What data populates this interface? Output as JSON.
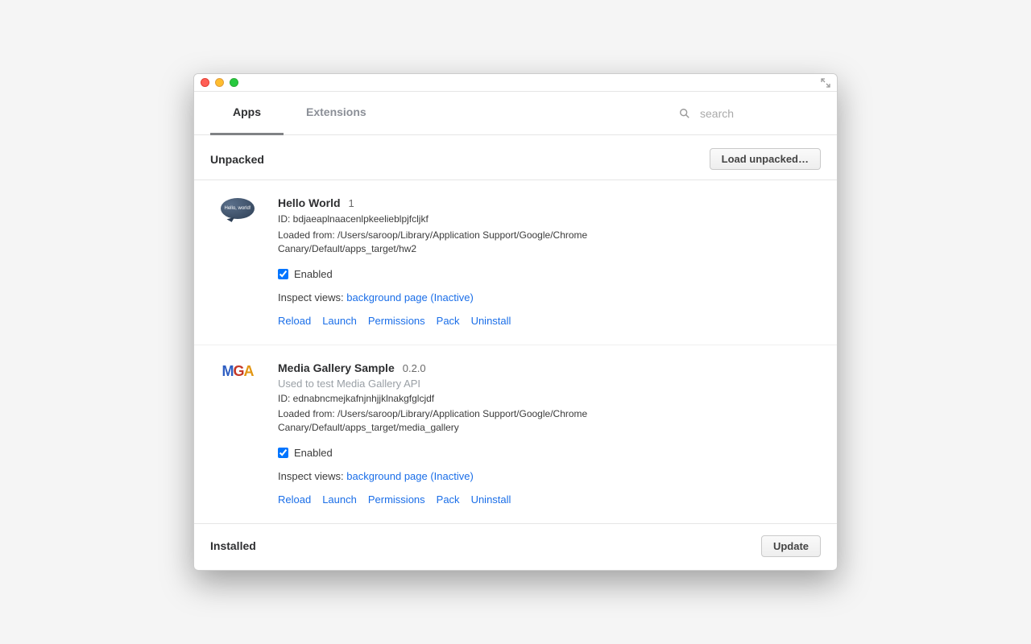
{
  "tabs": {
    "apps": "Apps",
    "extensions": "Extensions"
  },
  "search": {
    "placeholder": "search"
  },
  "sections": {
    "unpacked": {
      "title": "Unpacked",
      "load_button": "Load unpacked…"
    },
    "installed": {
      "title": "Installed",
      "update_button": "Update"
    }
  },
  "labels": {
    "enabled": "Enabled",
    "inspect_prefix": "Inspect views: ",
    "id_prefix": "ID: ",
    "loaded_prefix": "Loaded from: "
  },
  "actions": {
    "reload": "Reload",
    "launch": "Launch",
    "permissions": "Permissions",
    "pack": "Pack",
    "uninstall": "Uninstall"
  },
  "apps": [
    {
      "icon_text": "Hello, world!",
      "name": "Hello World",
      "version": "1",
      "description": "",
      "id": "bdjaeaplnaacenlpkeelieblpjfcljkf",
      "loaded_from": "/Users/saroop/Library/Application Support/Google/Chrome Canary/Default/apps_target/hw2",
      "enabled": true,
      "inspect_link": "background page (Inactive)"
    },
    {
      "name": "Media Gallery Sample",
      "version": "0.2.0",
      "description": "Used to test Media Gallery API",
      "id": "ednabncmejkafnjnhjjklnakgfglcjdf",
      "loaded_from": "/Users/saroop/Library/Application Support/Google/Chrome Canary/Default/apps_target/media_gallery",
      "enabled": true,
      "inspect_link": "background page (Inactive)"
    }
  ]
}
